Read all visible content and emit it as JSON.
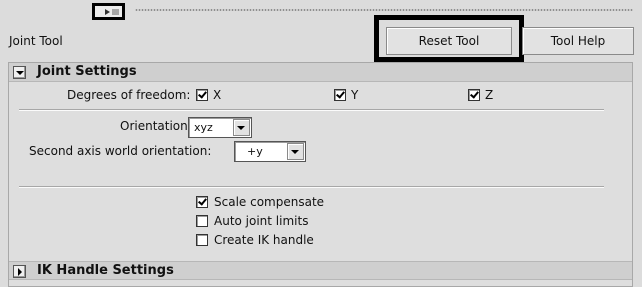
{
  "toolbar": {
    "title": "Joint Tool",
    "reset_label": "Reset Tool",
    "help_label": "Tool Help"
  },
  "joint_settings": {
    "header": "Joint Settings",
    "dof_label": "Degrees of freedom:",
    "dof": [
      {
        "label": "X",
        "checked": true
      },
      {
        "label": "Y",
        "checked": true
      },
      {
        "label": "Z",
        "checked": true
      }
    ],
    "orientation_label": "Orientation:",
    "orientation_value": "xyz",
    "second_axis_label": "Second axis world orientation:",
    "second_axis_value": "+y",
    "options": [
      {
        "label": "Scale compensate",
        "checked": true
      },
      {
        "label": "Auto joint limits",
        "checked": false
      },
      {
        "label": "Create IK handle",
        "checked": false
      }
    ]
  },
  "ik_settings": {
    "header": "IK Handle Settings"
  }
}
